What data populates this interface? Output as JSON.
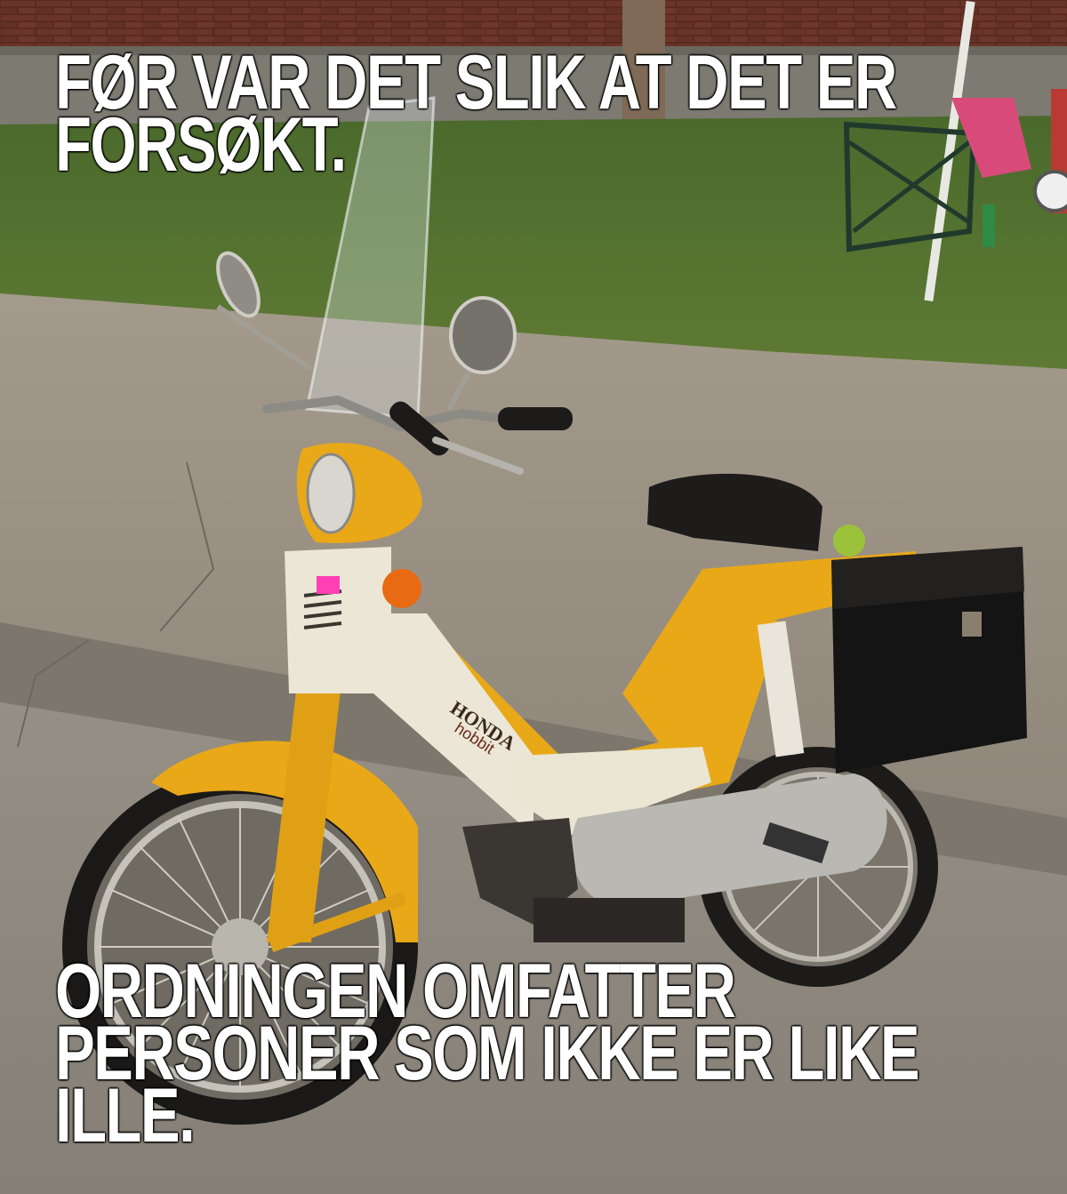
{
  "meme": {
    "top_text": "FØR VAR DET SLIK AT DET ER FORSØKT.",
    "bottom_text": "ORDNINGEN OMFATTER PERSONER SOM IKKE ER LIKE ILLE."
  },
  "photo": {
    "subject": "yellow and white moped with black saddlebag parked at a curb",
    "badge_text": "HONDA",
    "model_text": "hobbit"
  },
  "colors": {
    "moped_yellow": "#e8a818",
    "moped_white": "#ece6d6",
    "caption": "#ffffff"
  }
}
